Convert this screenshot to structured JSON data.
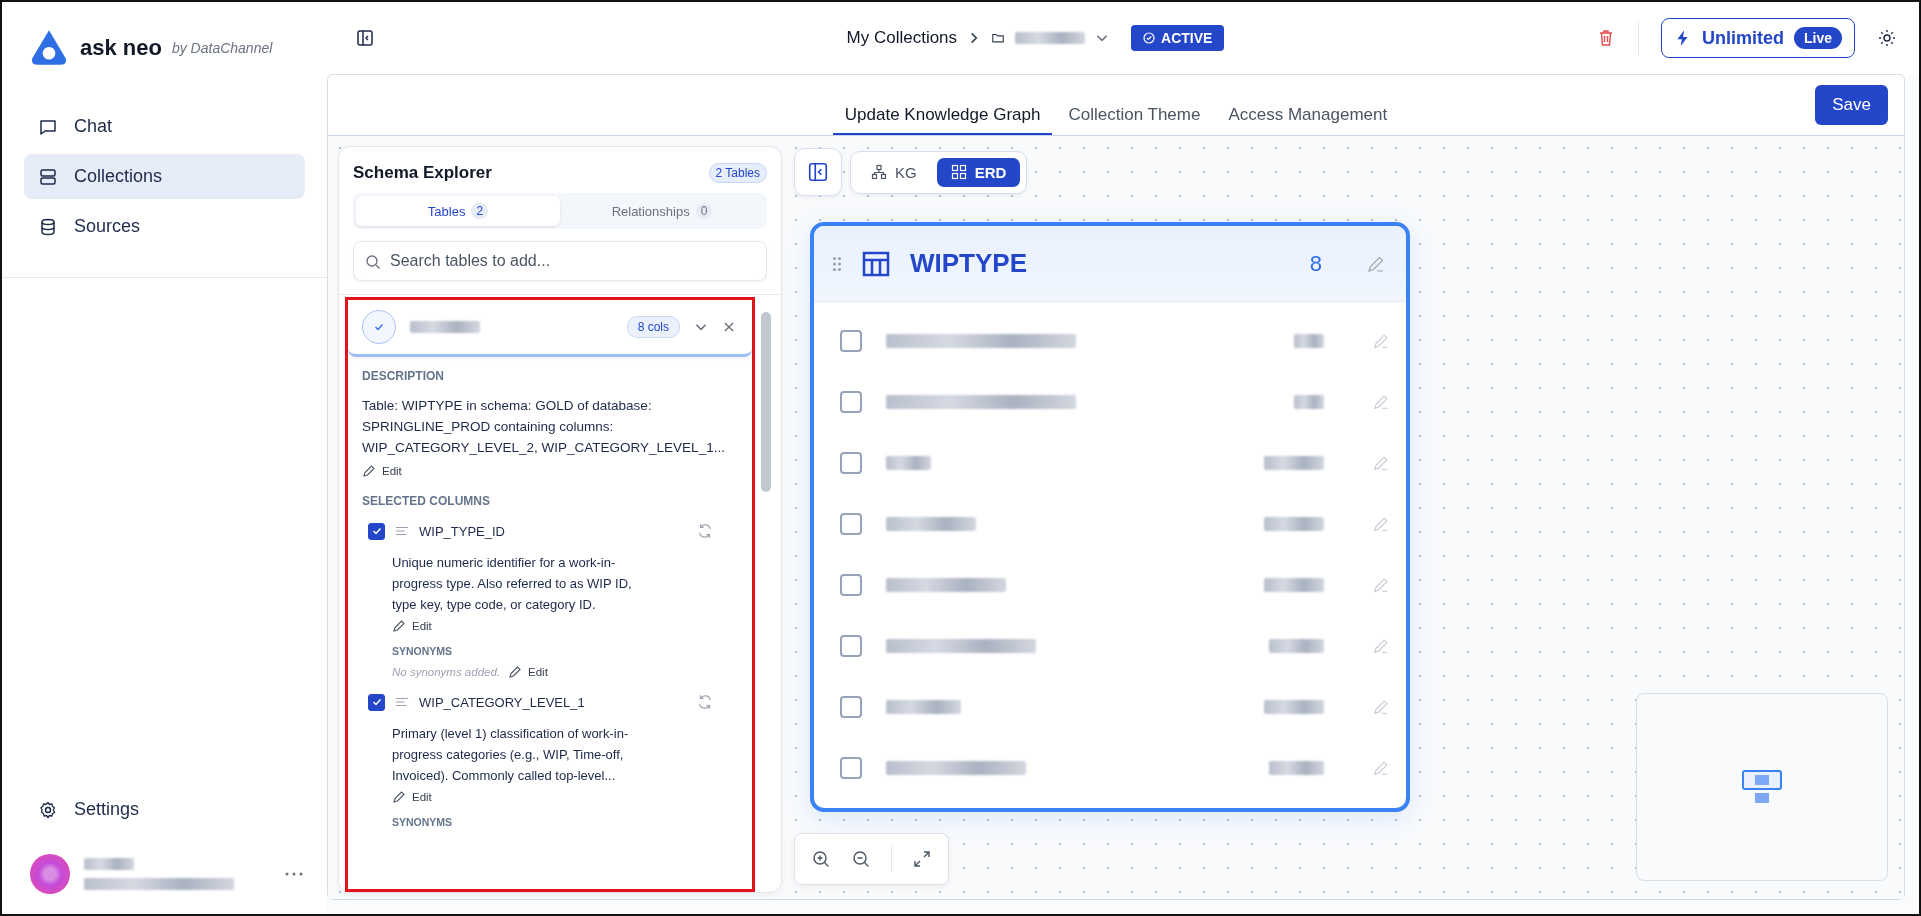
{
  "app": {
    "name": "ask neo",
    "byline": "by DataChannel"
  },
  "nav": [
    {
      "label": "Chat",
      "kind": "chat",
      "selected": false
    },
    {
      "label": "Collections",
      "kind": "collections",
      "selected": true
    },
    {
      "label": "Sources",
      "kind": "sources",
      "selected": false
    }
  ],
  "footer_nav": {
    "label": "Settings"
  },
  "breadcrumb": {
    "root": "My Collections",
    "status": "ACTIVE"
  },
  "plan": {
    "label": "Unlimited",
    "badge": "Live"
  },
  "tabs": [
    {
      "label": "Update Knowledge Graph",
      "selected": true
    },
    {
      "label": "Collection Theme",
      "selected": false
    },
    {
      "label": "Access Management",
      "selected": false
    }
  ],
  "save": "Save",
  "schema": {
    "title": "Schema Explorer",
    "count": "2 Tables",
    "subtabs": [
      {
        "label": "Tables",
        "count": "2",
        "selected": true
      },
      {
        "label": "Relationships",
        "count": "0",
        "selected": false
      }
    ],
    "search_placeholder": "Search tables to add...",
    "table_card": {
      "checked": true,
      "cols": "8 cols",
      "description_label": "DESCRIPTION",
      "description": "Table: WIPTYPE in schema: GOLD of database: SPRINGLINE_PROD containing columns: WIP_CATEGORY_LEVEL_2, WIP_CATEGORY_LEVEL_1...",
      "edit": "Edit",
      "columns_label": "SELECTED COLUMNS",
      "columns": [
        {
          "name": "WIP_TYPE_ID",
          "checked": true,
          "description": "Unique numeric identifier for a work-in-progress type. Also referred to as WIP ID, type key, type code, or category ID.",
          "edit": "Edit",
          "synonyms_label": "SYNONYMS",
          "synonyms": "No synonyms added.",
          "synonyms_edit": "Edit"
        },
        {
          "name": "WIP_CATEGORY_LEVEL_1",
          "checked": true,
          "description": "Primary (level 1) classification of work-in-progress categories (e.g., WIP, Time-off, Invoiced). Commonly called top-level...",
          "edit": "Edit",
          "synonyms_label": "SYNONYMS"
        }
      ]
    }
  },
  "view_toggle": [
    {
      "label": "KG",
      "kind": "kg",
      "selected": false
    },
    {
      "label": "ERD",
      "kind": "erd",
      "selected": true
    }
  ],
  "erd": {
    "title": "WIPTYPE",
    "count": "8",
    "rows": [
      {
        "checked": false
      },
      {
        "checked": false
      },
      {
        "checked": false
      },
      {
        "checked": false
      },
      {
        "checked": false
      },
      {
        "checked": false
      },
      {
        "checked": false
      },
      {
        "checked": false
      }
    ]
  }
}
